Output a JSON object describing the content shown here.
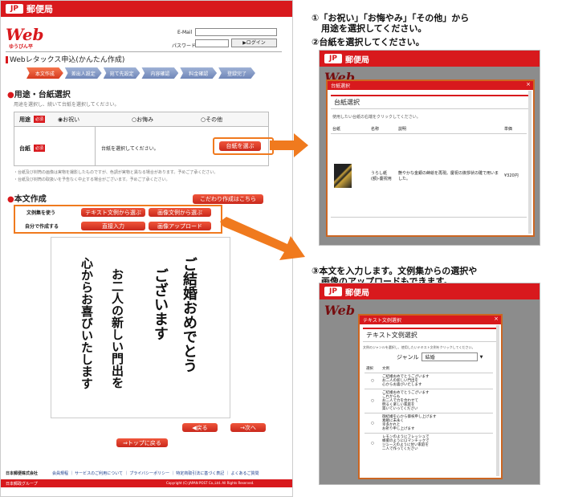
{
  "main": {
    "header_brand": "郵便局",
    "jp_mark": "JP",
    "web_logo": "Web",
    "web_logo_sub": "ゆうびん平",
    "email_label": "E-Mail",
    "password_label": "パスワード",
    "login_button": "▶ログイン",
    "page_title": "Webレタックス申込(かんたん作成)",
    "steps": [
      "本文作成",
      "差出人設定",
      "宛て先設定",
      "内容確認",
      "料金確認",
      "登録完了"
    ],
    "section1_title": "用途・台紙選択",
    "section1_intro": "用途を選択し、続いて台紙を選択してください。",
    "purpose_label": "用途",
    "required_badge": "必須",
    "purpose_options": [
      "お祝い",
      "お悔み",
      "その他"
    ],
    "mount_label": "台紙",
    "mount_text": "台紙を選択してください。",
    "mount_button": "台紙を選ぶ",
    "note1": "・台紙及び封筒の画像は実物を撮影したものですが、色調が実物と異なる場合があります。予めご了承ください。",
    "note2": "・台紙及び封筒の取扱いを予告なく中止する場合がございます。予めご了承ください。",
    "section2_title": "本文作成",
    "kodawari_button": "こだわり作成はこちら",
    "row1_label": "文例集を使う",
    "row1_btn1": "テキスト文例から選ぶ",
    "row1_btn2": "画像文例から選ぶ",
    "row2_label": "自分で作成する",
    "row2_btn1": "直接入力",
    "row2_btn2": "画像アップロード",
    "body_lines": [
      "ご結婚おめでとう",
      "ございます",
      "お二人の新しい門出を",
      "心からお喜びいたします"
    ],
    "back_button": "◀戻る",
    "next_button": "→次へ",
    "top_button": "⇒トップに戻る",
    "company": "日本郵便株式会社",
    "footer_links": "会員規程 ｜ サービスのご利用について ｜ プライバシーポリシー ｜ 特定商取引法に基づく表記 ｜ よくあるご質問",
    "copyright": "Copyright (C) JAPAN POST Co.,Ltd. All Rights Reserved.",
    "group": "日本郵政グループ"
  },
  "captions": {
    "c1_line1": "①「お祝い」「お悔やみ」「その他」から",
    "c1_line2": "用途を選択してください。",
    "c2": "②台紙を選択してください。",
    "c3_line1": "③本文を入力します。文例集からの選択や",
    "c3_line2": "画像のアップロードもできます。"
  },
  "shot2": {
    "brand": "郵便局",
    "web_logo": "Web",
    "modal_title": "台紙選択",
    "section": "台紙選択",
    "intro": "使用したい台紙の右端をクリックしてください。",
    "cols": [
      "台紙",
      "名称",
      "説明",
      "単価"
    ],
    "item_name": "うらし紙(額)-慶祝用",
    "item_desc": "艶やかな金銀の蒔絵を再現。慶祝の挨拶状の雛で用いました。",
    "item_price": "¥320円"
  },
  "shot3": {
    "brand": "郵便局",
    "web_logo": "Web",
    "modal_title": "テキスト文例選択",
    "section": "テキスト文例選択",
    "intro": "文例のジャンルを選択し、使用したいテキスト文例をクリックしてください。",
    "genre_label": "ジャンル",
    "genre_value": "結婚",
    "cols": [
      "選択",
      "文例"
    ],
    "examples": [
      [
        "ご結婚おめでとうございます",
        "お二人の新しい門出を",
        "心からお喜びいたします"
      ],
      [
        "ご結婚おめでとうございます",
        "これからも",
        "お二人で力を合わせて",
        "明るく楽しい家庭を",
        "築いていってください"
      ],
      [
        "御結婚を心から御祝申し上げます",
        "素敵に末永く",
        "幸多かれと",
        "お祈り申し上げます"
      ],
      [
        "レモンのようにフレッシュで",
        "蜂蜜のようにロマンチックで",
        "ジュースのように甘い家庭を",
        "二人で作ってください"
      ]
    ]
  },
  "colors": {
    "accent": "#d8191d",
    "orange": "#f07a1e"
  }
}
